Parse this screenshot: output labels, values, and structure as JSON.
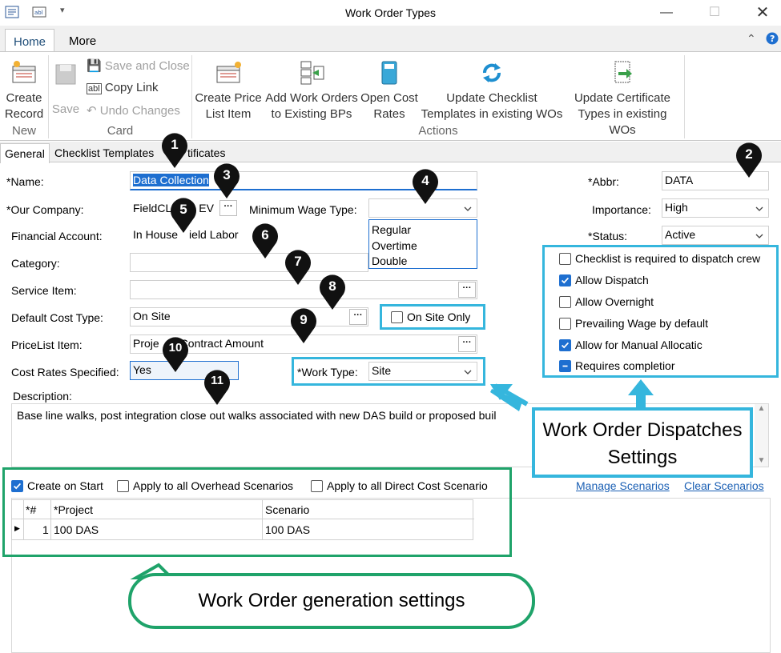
{
  "window": {
    "title": "Work Order Types",
    "qa_menu": "▾"
  },
  "ribbon": {
    "tabs": [
      "Home",
      "More"
    ],
    "new": {
      "create_record": "Create Record",
      "group": "New"
    },
    "card": {
      "save": "Save",
      "save_close": "Save and Close",
      "copy_link": "Copy Link",
      "undo": "Undo Changes",
      "group": "Card"
    },
    "actions": {
      "price_list": "Create Price List Item",
      "add_wo": "Add Work Orders to Existing BPs",
      "open_cost": "Open Cost Rates",
      "update_checklist": "Update Checklist Templates in existing WOs",
      "update_cert": "Update Certificate Types in existing WOs",
      "group": "Actions"
    }
  },
  "form_tabs": [
    "General",
    "Checklist Templates",
    "tificates"
  ],
  "form": {
    "name_label": "*Name:",
    "name_value": "Data Collection",
    "company_label": "*Our Company:",
    "company_value": "FieldCL",
    "company_tail": "EV",
    "min_wage_label": "Minimum Wage Type:",
    "min_wage_options": [
      "Regular",
      "Overtime",
      "Double"
    ],
    "fin_label": "Financial Account:",
    "fin_value": "In House",
    "fin_value_tail": "ield Labor",
    "category_label": "Category:",
    "service_label": "Service Item:",
    "cost_type_label": "Default Cost Type:",
    "cost_type_value": "On Site",
    "onsite_only_label": "On Site Only",
    "pricelist_label": "PriceList Item:",
    "pricelist_value": "Proje",
    "pricelist_tail": "Contract Amount",
    "cost_rates_label": "Cost Rates Specified:",
    "cost_rates_value": "Yes",
    "work_type_label": "*Work Type:",
    "work_type_value": "Site",
    "description_label": "Description:",
    "description_value": "Base line walks, post integration close out walks associated with new DAS build or proposed buil",
    "abbr_label": "*Abbr:",
    "abbr_value": "DATA",
    "importance_label": "Importance:",
    "importance_value": "High",
    "status_label": "*Status:",
    "status_value": "Active"
  },
  "dispatch": {
    "items": [
      {
        "label": "Checklist is required to dispatch crew",
        "state": "off"
      },
      {
        "label": "Allow Dispatch",
        "state": "on"
      },
      {
        "label": "Allow Overnight",
        "state": "off"
      },
      {
        "label": "Prevailing Wage by default",
        "state": "off"
      },
      {
        "label": "Allow for Manual Allocatic",
        "state": "on"
      },
      {
        "label": "Requires completior",
        "state": "ind"
      }
    ]
  },
  "scenarios": {
    "create_on_start": "Create on Start",
    "overhead": "Apply to all Overhead Scenarios",
    "direct": "Apply to all Direct Cost Scenario",
    "manage": "Manage Scenarios",
    "clear": "Clear Scenarios",
    "columns": [
      "*#",
      "*Project",
      "Scenario"
    ],
    "rows": [
      {
        "num": "1",
        "project": "100 DAS",
        "scenario": "100 DAS"
      }
    ]
  },
  "callouts": {
    "dispatch": "Work Order Dispatches Settings",
    "generation": "Work Order generation settings",
    "pins": [
      "1",
      "2",
      "3",
      "4",
      "5",
      "6",
      "7",
      "8",
      "9",
      "10",
      "11"
    ]
  },
  "colors": {
    "teal": "#35b6dd",
    "green": "#1fa36a",
    "accent": "#1e6fd0"
  }
}
